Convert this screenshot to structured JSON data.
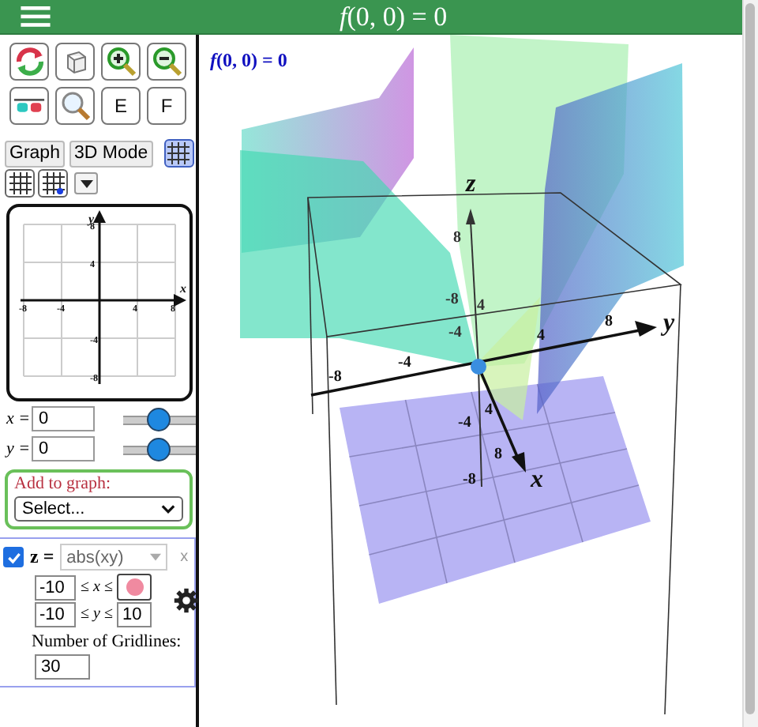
{
  "header": {
    "title": "*f*(0, 0) = 0"
  },
  "tools": [
    {
      "kind": "rotate"
    },
    {
      "kind": "cube"
    },
    {
      "kind": "zoom-in"
    },
    {
      "kind": "zoom-out"
    },
    {
      "kind": "glasses"
    },
    {
      "kind": "magnifier"
    },
    {
      "kind": "text",
      "label": "E"
    },
    {
      "kind": "text",
      "label": "F"
    }
  ],
  "modes": [
    {
      "label": "Graph"
    },
    {
      "label": "3D Mode"
    }
  ],
  "grid_options": [
    {
      "kind": "grid",
      "selected": true
    },
    {
      "kind": "grid",
      "selected": false
    },
    {
      "kind": "grid-dot",
      "selected": false
    },
    {
      "kind": "menu",
      "selected": false
    }
  ],
  "mini_graph": {
    "x_label": "x",
    "y_label": "y",
    "x_ticks": [
      "-8",
      "-4",
      "4",
      "8"
    ],
    "y_ticks": [
      "8",
      "4",
      "-4",
      "-8"
    ]
  },
  "point": [
    {
      "label": "x =",
      "value": "0",
      "level": 0.5
    },
    {
      "label": "y =",
      "value": "0",
      "level": 0.5
    }
  ],
  "add_to_graph": {
    "label": "Add to graph:",
    "select": "Select..."
  },
  "function": {
    "checked": true,
    "lhs": "z =",
    "expr": "abs(xy)",
    "remove": "x",
    "x_min": "-10",
    "x_range": "≤ *x* ≤",
    "y_min": "-10",
    "y_range": "≤ *y* ≤",
    "y_max": "10",
    "color": "#f08aa0",
    "gridlines_label": "Number of Gridlines:",
    "gridlines": "30"
  },
  "plot": {
    "label": "*f*(0, 0) = 0",
    "y_axis": {
      "name": "y",
      "ticks": [
        "-8",
        "-4",
        "4",
        "8"
      ]
    },
    "z_axis": {
      "name": "z",
      "ticks": [
        "8",
        "-8",
        "4",
        "-4"
      ]
    },
    "x_axis": {
      "name": "x",
      "ticks": [
        "4",
        "-4",
        "8",
        "-8"
      ]
    }
  }
}
